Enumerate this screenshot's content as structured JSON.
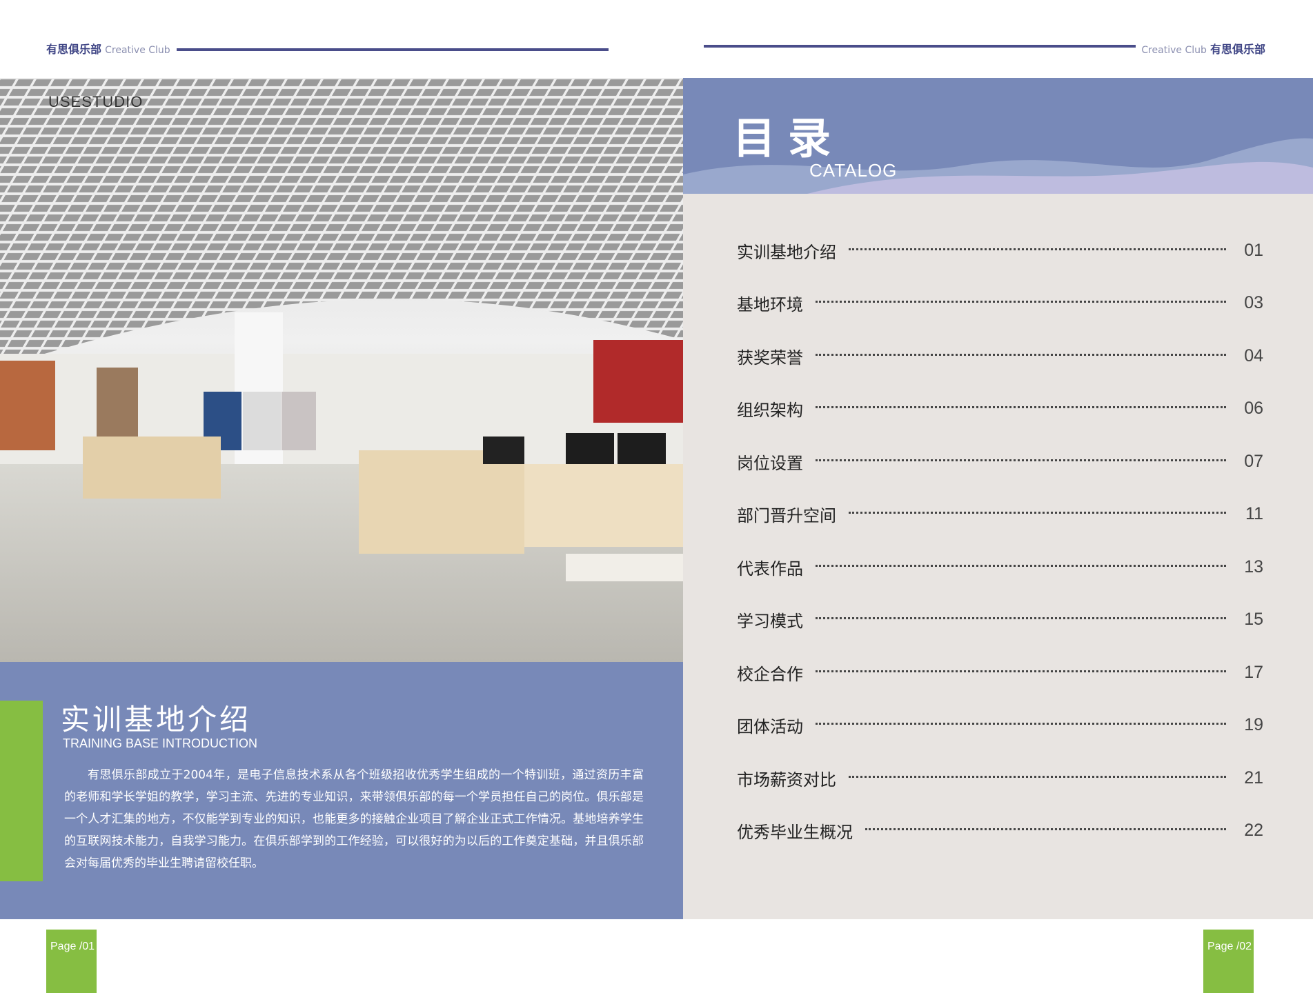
{
  "header": {
    "left_cn": "有思俱乐部",
    "left_en": "Creative Club",
    "right_en": "Creative Club",
    "right_cn": "有思俱乐部"
  },
  "photo": {
    "watermark": "USESTUDIO"
  },
  "intro": {
    "title": "实训基地介绍",
    "subtitle": "TRAINING BASE INTRODUCTION",
    "body": "有思俱乐部成立于2004年，是电子信息技术系从各个班级招收优秀学生组成的一个特训班，通过资历丰富的老师和学长学姐的教学，学习主流、先进的专业知识，来带领俱乐部的每一个学员担任自己的岗位。俱乐部是一个人才汇集的地方，不仅能学到专业的知识，也能更多的接触企业项目了解企业正式工作情况。基地培养学生的互联网技术能力，自我学习能力。在俱乐部学到的工作经验，可以很好的为以后的工作奠定基础，并且俱乐部会对每届优秀的毕业生聘请留校任职。"
  },
  "catalog": {
    "title": "目录",
    "subtitle": "CATALOG",
    "items": [
      {
        "label": "实训基地介绍",
        "page": "01"
      },
      {
        "label": "基地环境",
        "page": "03"
      },
      {
        "label": "获奖荣誉",
        "page": "04"
      },
      {
        "label": "组织架构",
        "page": "06"
      },
      {
        "label": "岗位设置",
        "page": "07"
      },
      {
        "label": "部门晋升空间",
        "page": "11"
      },
      {
        "label": "代表作品",
        "page": "13"
      },
      {
        "label": "学习模式",
        "page": "15"
      },
      {
        "label": "校企合作",
        "page": "17"
      },
      {
        "label": "团体活动",
        "page": "19"
      },
      {
        "label": "市场薪资对比",
        "page": "21"
      },
      {
        "label": "优秀毕业生概况",
        "page": "22"
      }
    ]
  },
  "footer": {
    "left_page": "Page /01",
    "right_page": "Page /02"
  },
  "colors": {
    "accent_blue": "#7889b8",
    "accent_green": "#86be42",
    "catalog_bg": "#e8e4e1",
    "rule": "#4a4d8a"
  }
}
